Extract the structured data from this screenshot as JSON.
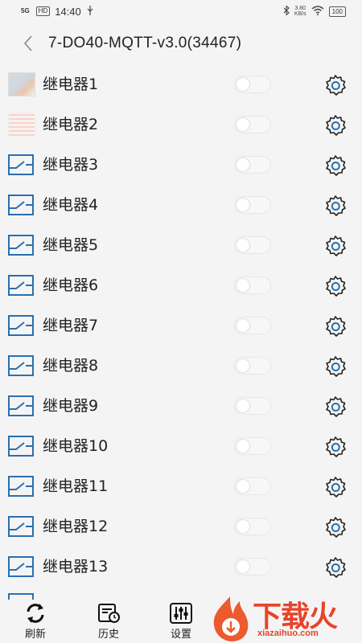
{
  "status_bar": {
    "network": "5G",
    "hd_badge": "HD",
    "time": "14:40",
    "speed_value": "3.80",
    "speed_unit": "KB/s",
    "battery": "100"
  },
  "header": {
    "title": "7-DO40-MQTT-v3.0(34467)"
  },
  "relays": [
    {
      "label": "继电器1",
      "on": false
    },
    {
      "label": "继电器2",
      "on": false
    },
    {
      "label": "继电器3",
      "on": false
    },
    {
      "label": "继电器4",
      "on": false
    },
    {
      "label": "继电器5",
      "on": false
    },
    {
      "label": "继电器6",
      "on": false
    },
    {
      "label": "继电器7",
      "on": false
    },
    {
      "label": "继电器8",
      "on": false
    },
    {
      "label": "继电器9",
      "on": false
    },
    {
      "label": "继电器10",
      "on": false
    },
    {
      "label": "继电器11",
      "on": false
    },
    {
      "label": "继电器12",
      "on": false
    },
    {
      "label": "继电器13",
      "on": false
    }
  ],
  "tabs": [
    {
      "label": "刷新",
      "icon": "refresh-icon"
    },
    {
      "label": "历史",
      "icon": "history-icon"
    },
    {
      "label": "设置",
      "icon": "settings-sliders-icon"
    }
  ],
  "watermark": {
    "text": "下载火",
    "url": "xiazaihuo.com"
  },
  "colors": {
    "accent": "#2a6fb0",
    "watermark": "#e8432a",
    "background": "#f4f4f4"
  }
}
